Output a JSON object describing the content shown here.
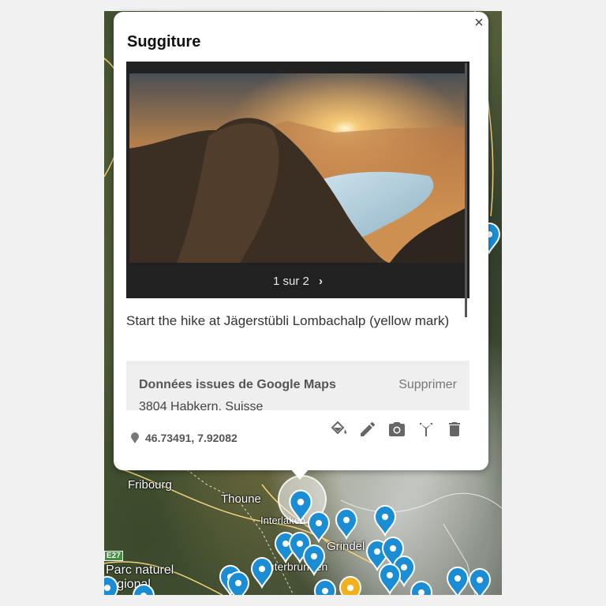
{
  "map": {
    "labels": {
      "fribourg": "Fribourg",
      "thoune": "Thoune",
      "interlaken": "Interlaken",
      "grindelwald": "Grindel",
      "lauterbrunnen": "auterbrunnen",
      "parc_line1": "Parc naturel",
      "parc_line2": "régional",
      "road_badge": "E27"
    },
    "colors": {
      "marker_blue": "#1a8dd4",
      "marker_yellow": "#f2b01e"
    }
  },
  "popup": {
    "title": "Suggiture",
    "close_label": "×",
    "gallery": {
      "pager_text": "1 sur 2",
      "next_label": "›"
    },
    "description": "Start the hike at Jägerstübli Lombachalp (yellow mark)",
    "google_maps": {
      "title": "Données issues de Google Maps",
      "remove_label": "Supprimer",
      "address": "3804 Habkern, Suisse"
    },
    "coordinates": "46.73491, 7.92082",
    "tools": [
      "paint-bucket-icon",
      "pencil-icon",
      "camera-icon",
      "directions-icon",
      "trash-icon"
    ]
  }
}
